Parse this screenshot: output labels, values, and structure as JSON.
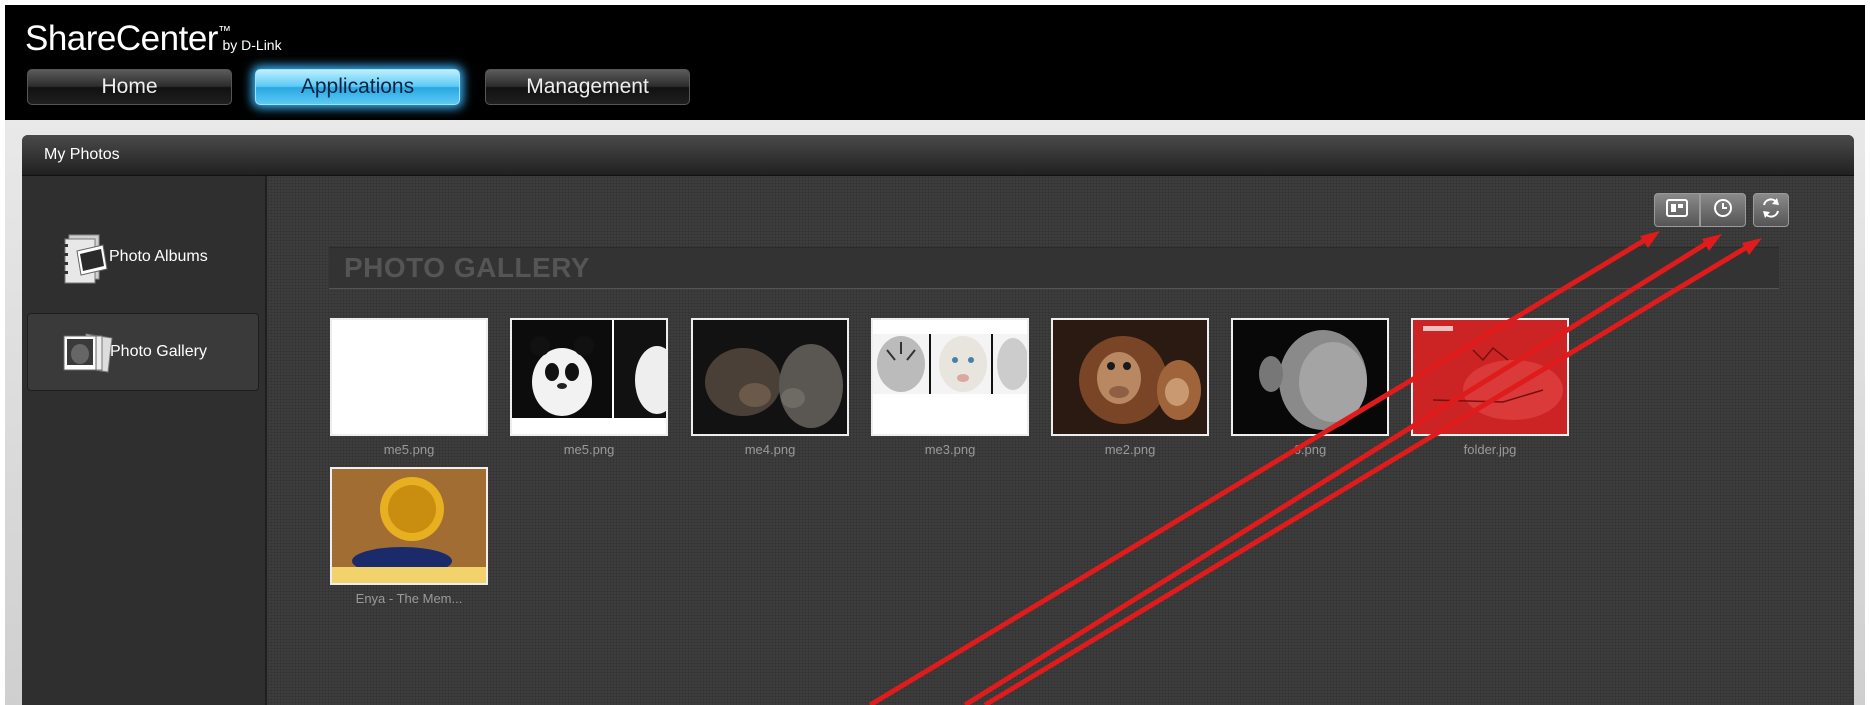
{
  "brand": {
    "name": "ShareCenter",
    "tm": "™",
    "by": "by D-Link"
  },
  "nav": [
    {
      "label": "Home",
      "active": false
    },
    {
      "label": "Applications",
      "active": true
    },
    {
      "label": "Management",
      "active": false
    }
  ],
  "panel": {
    "title": "My Photos"
  },
  "sidebar": {
    "items": [
      {
        "label": "Photo Albums",
        "icon": "photo-albums-icon"
      },
      {
        "label": "Photo Gallery",
        "icon": "photo-gallery-icon",
        "selected": true
      }
    ]
  },
  "toolbar": {
    "buttons": [
      {
        "icon": "slideshow-icon"
      },
      {
        "icon": "clock-icon"
      },
      {
        "icon": "rotate-icon"
      }
    ]
  },
  "gallery": {
    "title": "PHOTO GALLERY",
    "photos": [
      {
        "name": "me5.png"
      },
      {
        "name": "me5.png"
      },
      {
        "name": "me4.png"
      },
      {
        "name": "me3.png"
      },
      {
        "name": "me2.png"
      },
      {
        "name": "6.png"
      },
      {
        "name": "folder.jpg"
      },
      {
        "name": "Enya - The Mem..."
      }
    ]
  },
  "colors": {
    "accent": "#3bb9ff",
    "annotation_arrow": "#e01b1b"
  }
}
